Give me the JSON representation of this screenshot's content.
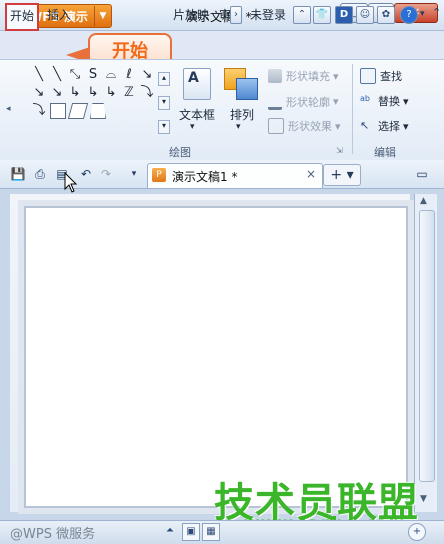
{
  "app": {
    "menu_label": "WPS 演示",
    "logo_glyph": "P",
    "document_title": "演示文稿1 *",
    "window_buttons": [
      "_",
      "□",
      "✕"
    ]
  },
  "tabs": [
    "开始",
    "插入",
    "幻灯片放映",
    "审"
  ],
  "tabs_visible": {
    "home": "开始",
    "insert": "插入",
    "slideshow": "片放映",
    "review": "审"
  },
  "callout": "开始",
  "right_tabs": {
    "login": "未登录",
    "icons": [
      "menu-up-icon",
      "shirt-icon",
      "d-icon",
      "people-icon",
      "skin-icon",
      "help-icon"
    ]
  },
  "ribbon": {
    "shape_glyphs": [
      "\\",
      "\\",
      "⇘",
      "S",
      "⌓",
      "2",
      "↘",
      "↘",
      "↘",
      "⤷",
      "⤷",
      "⤷",
      "ℤ",
      "⤵",
      "⤵",
      "▭",
      "▱",
      "⏢"
    ],
    "textbox_label": "文本框",
    "arrange_label": "排列",
    "shape_fill": "形状填充",
    "shape_outline": "形状轮廓",
    "shape_effect": "形状效果",
    "find_label": "查找",
    "replace_label": "替换",
    "select_label": "选择",
    "group_draw": "绘图",
    "group_edit": "编辑"
  },
  "doc_tab": {
    "name": "演示文稿1 *",
    "close": "×"
  },
  "plus_label": "+ ▾",
  "status": {
    "text": "@WPS 微服务"
  },
  "watermark": {
    "text": "技术员联盟",
    "url": "www.jsgho.com"
  },
  "colors": {
    "accent_orange": "#e0700f",
    "highlight_red": "#d23c3c",
    "watermark_green": "#3bb62a"
  }
}
